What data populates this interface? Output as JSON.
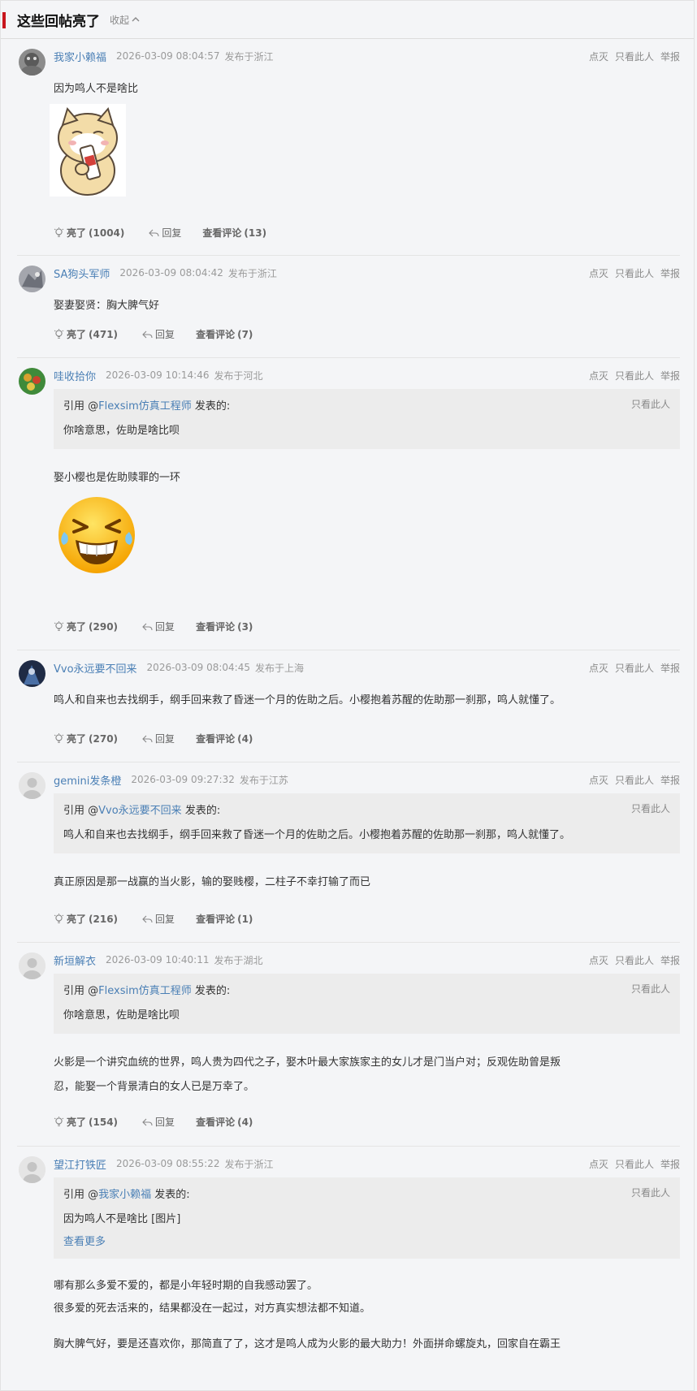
{
  "section": {
    "title": "这些回帖亮了",
    "collapse_label": "收起"
  },
  "actions": {
    "dim": "点灭",
    "only": "只看此人",
    "report": "举报"
  },
  "quote_labels": {
    "prefix": "引用 @",
    "suffix": " 发表的:",
    "only": "只看此人",
    "more": "查看更多"
  },
  "footer_labels": {
    "light": "亮了",
    "reply": "回复",
    "comments": "查看评论"
  },
  "posts": [
    {
      "user": "我家小赖福",
      "time": "2026-03-09 08:04:57",
      "location": "发布于浙江",
      "content": [
        "因为鸣人不是啥比"
      ],
      "light": "(1004)",
      "comments": "(13)",
      "image": "dog-sticker"
    },
    {
      "user": "SA狗头军师",
      "time": "2026-03-09 08:04:42",
      "location": "发布于浙江",
      "content": [
        "娶妻娶贤：胸大脾气好"
      ],
      "light": "(471)",
      "comments": "(7)"
    },
    {
      "user": "哇收拾你",
      "time": "2026-03-09 10:14:46",
      "location": "发布于河北",
      "quote": {
        "user": "Flexsim仿真工程师",
        "text": "你啥意思，佐助是啥比呗"
      },
      "content": [
        "娶小樱也是佐助赎罪的一环"
      ],
      "light": "(290)",
      "comments": "(3)",
      "image": "laugh-emoji"
    },
    {
      "user": "Vvo永远要不回来",
      "time": "2026-03-09 08:04:45",
      "location": "发布于上海",
      "content": [
        "鸣人和自来也去找纲手，纲手回来救了昏迷一个月的佐助之后。小樱抱着苏醒的佐助那一刹那，鸣人就懂了。"
      ],
      "light": "(270)",
      "comments": "(4)"
    },
    {
      "user": "gemini发条橙",
      "time": "2026-03-09 09:27:32",
      "location": "发布于江苏",
      "quote": {
        "user": "Vvo永远要不回来",
        "text": "鸣人和自来也去找纲手，纲手回来救了昏迷一个月的佐助之后。小樱抱着苏醒的佐助那一刹那，鸣人就懂了。"
      },
      "content": [
        "真正原因是那一战赢的当火影，输的娶贱樱，二柱子不幸打输了而已"
      ],
      "light": "(216)",
      "comments": "(1)"
    },
    {
      "user": "新垣解衣",
      "time": "2026-03-09 10:40:11",
      "location": "发布于湖北",
      "quote": {
        "user": "Flexsim仿真工程师",
        "text": "你啥意思，佐助是啥比呗"
      },
      "content": [
        "火影是一个讲究血统的世界，鸣人贵为四代之子，娶木叶最大家族家主的女儿才是门当户对；反观佐助曾是叛",
        "忍，能娶一个背景清白的女人已是万幸了。"
      ],
      "light": "(154)",
      "comments": "(4)"
    },
    {
      "user": "望江打铁匠",
      "time": "2026-03-09 08:55:22",
      "location": "发布于浙江",
      "quote": {
        "user": "我家小赖福",
        "text": "因为鸣人不是啥比 [图片]",
        "more": true
      },
      "content": [
        "哪有那么多爱不爱的，都是小年轻时期的自我感动罢了。",
        "很多爱的死去活来的，结果都没在一起过，对方真实想法都不知道。",
        "胸大脾气好，要是还喜欢你，那简直了了，这才是鸣人成为火影的最大助力！外面拼命螺旋丸，回家自在霸王"
      ]
    }
  ]
}
